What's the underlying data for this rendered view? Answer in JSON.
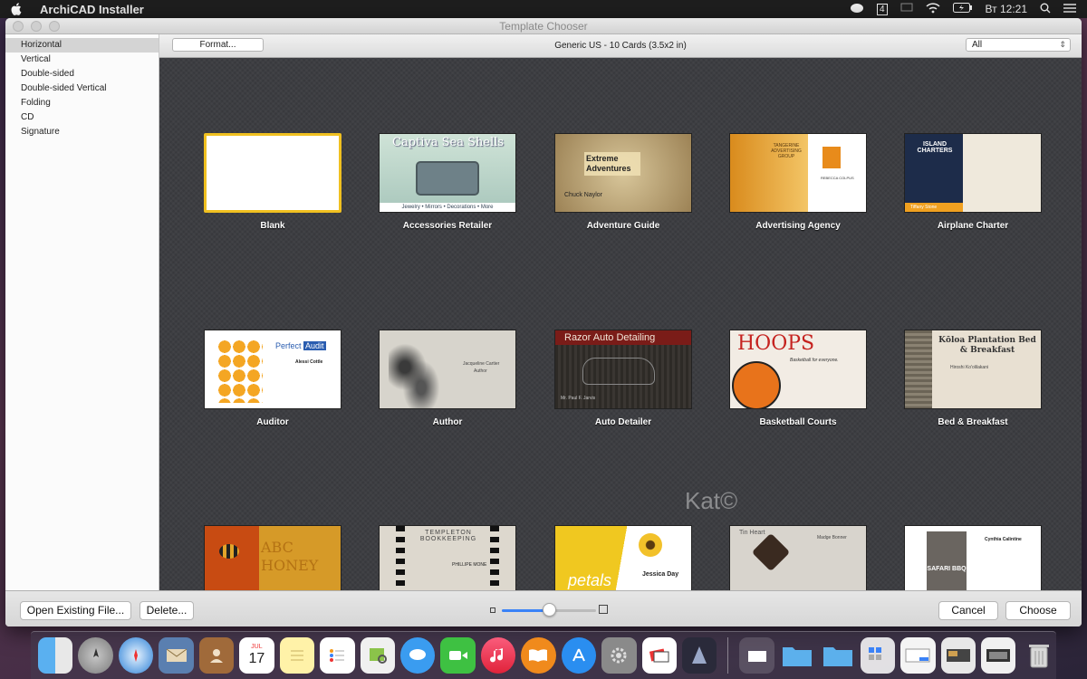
{
  "menubar": {
    "app_name": "ArchiCAD Installer",
    "clock": "Вт 12:21",
    "badge": "4"
  },
  "window": {
    "title": "Template Chooser"
  },
  "sidebar": {
    "items": [
      {
        "label": "Horizontal",
        "selected": true
      },
      {
        "label": "Vertical"
      },
      {
        "label": "Double-sided"
      },
      {
        "label": "Double-sided Vertical"
      },
      {
        "label": "Folding"
      },
      {
        "label": "CD"
      },
      {
        "label": "Signature"
      }
    ]
  },
  "toolbar": {
    "format_label": "Format...",
    "size_label": "Generic US - 10 Cards (3.5x2 in)",
    "filter_value": "All"
  },
  "templates": [
    {
      "label": "Blank"
    },
    {
      "label": "Accessories Retailer",
      "card_title": "Captiva Sea Shells",
      "card_sub": "Jewelry • Mirrors • Decorations • More"
    },
    {
      "label": "Adventure Guide",
      "card_title": "Extreme Adventures",
      "card_sub": "Chuck Naylor"
    },
    {
      "label": "Advertising Agency",
      "card_title": "TANGERINE ADVERTISING GROUP",
      "card_sub": "REBECCA COLPUS"
    },
    {
      "label": "Airplane Charter",
      "card_title": "ISLAND CHARTERS",
      "card_sub": "Tiffany Stone"
    },
    {
      "label": "Auditor",
      "card_title": "Perfect",
      "card_title2": "Audit",
      "card_sub": "Alessi Cottle"
    },
    {
      "label": "Author",
      "card_title": "Jacqueline Cartier",
      "card_sub": "Author"
    },
    {
      "label": "Auto Detailer",
      "card_title": "Razor Auto Detailing",
      "card_sub": "Mr. Paul F. Jarvis"
    },
    {
      "label": "Basketball Courts",
      "card_title": "HOOPS",
      "card_sub": "Basketball for everyone."
    },
    {
      "label": "Bed & Breakfast",
      "card_title": "Kōloa Plantation Bed & Breakfast",
      "card_sub": "Hiroshi Ko'olilakani"
    },
    {
      "label": "",
      "card_title": "ABC HONEY"
    },
    {
      "label": "",
      "card_title": "TEMPLETON BOOKKEEPING",
      "card_sub": "PHILLIPE MONE"
    },
    {
      "label": "",
      "card_title": "petals",
      "card_sub": "Jessica Day"
    },
    {
      "label": "",
      "card_title": "Tin Heart",
      "card_sub": "Madge Bonner"
    },
    {
      "label": "",
      "card_title": "SAFARI BBQ",
      "card_sub": "Cynthia Calintine"
    }
  ],
  "watermark": "Kat©",
  "bottom": {
    "open_label": "Open Existing File...",
    "delete_label": "Delete...",
    "cancel_label": "Cancel",
    "choose_label": "Choose",
    "zoom_level": 0.5
  },
  "dock": {
    "calendar_month": "JUL",
    "calendar_day": "17"
  },
  "colors": {
    "accent": "#3a82f7",
    "selection": "#f0c020"
  }
}
